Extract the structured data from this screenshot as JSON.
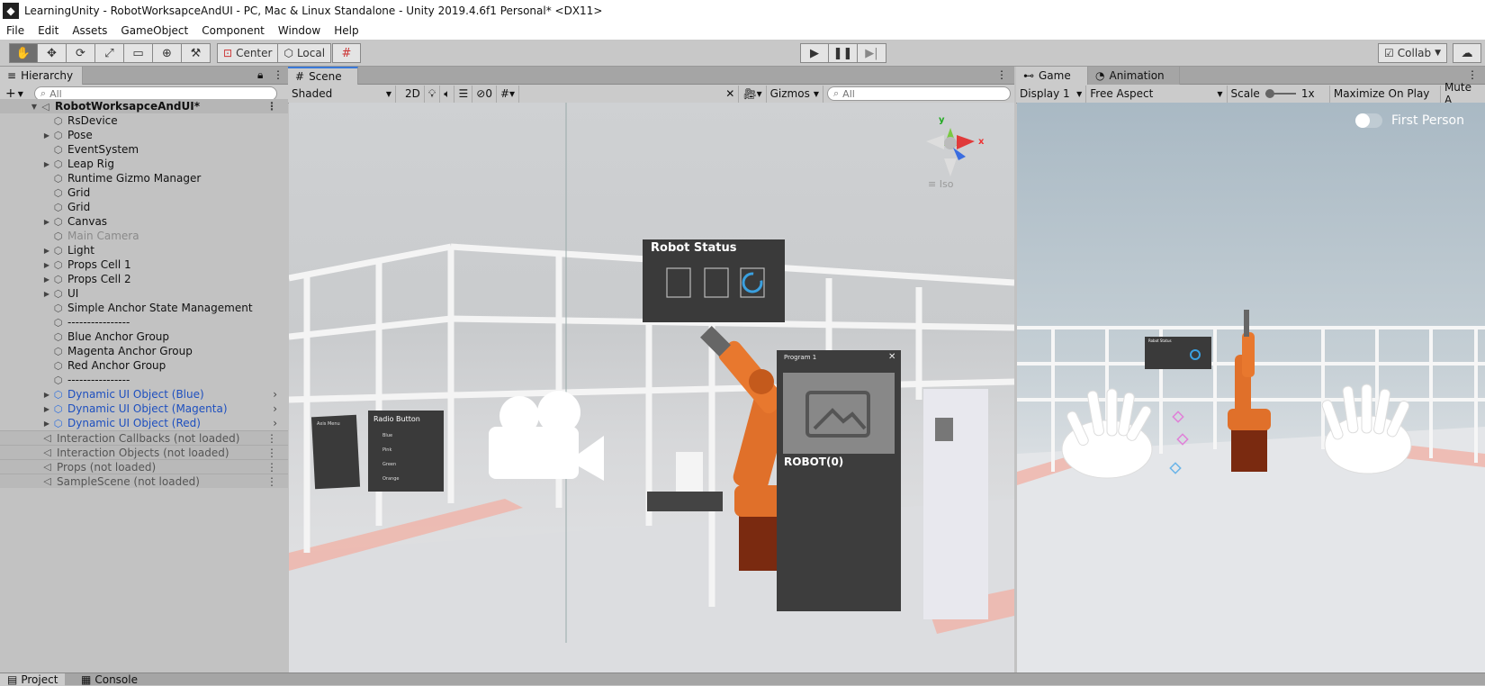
{
  "window": {
    "title": "LearningUnity - RobotWorksapceAndUI - PC, Mac & Linux Standalone - Unity 2019.4.6f1 Personal* <DX11>"
  },
  "menu": [
    "File",
    "Edit",
    "Assets",
    "GameObject",
    "Component",
    "Window",
    "Help"
  ],
  "toolbar": {
    "pivot_label": "Center",
    "space_label": "Local",
    "collab_label": "Collab"
  },
  "hierarchy": {
    "tab_label": "Hierarchy",
    "search_placeholder": "All",
    "root": "RobotWorksapceAndUI*",
    "items": [
      {
        "label": "RsDevice",
        "expand": false
      },
      {
        "label": "Pose",
        "expand": true
      },
      {
        "label": "EventSystem",
        "expand": false
      },
      {
        "label": "Leap Rig",
        "expand": true
      },
      {
        "label": "Runtime Gizmo Manager",
        "expand": false
      },
      {
        "label": "Grid",
        "expand": false
      },
      {
        "label": "Grid",
        "expand": false
      },
      {
        "label": "Canvas",
        "expand": true
      },
      {
        "label": "Main Camera",
        "expand": false
      },
      {
        "label": "Light",
        "expand": true
      },
      {
        "label": "Props Cell 1",
        "expand": true
      },
      {
        "label": "Props Cell 2",
        "expand": true
      },
      {
        "label": "UI",
        "expand": true
      },
      {
        "label": "Simple Anchor State Management",
        "expand": false
      },
      {
        "label": "----------------",
        "expand": false
      },
      {
        "label": "Blue Anchor Group",
        "expand": false
      },
      {
        "label": "Magenta Anchor Group",
        "expand": false
      },
      {
        "label": "Red Anchor Group",
        "expand": false
      },
      {
        "label": "----------------",
        "expand": false
      },
      {
        "label": "Dynamic UI Object (Blue)",
        "expand": true
      },
      {
        "label": "Dynamic UI Object (Magenta)",
        "expand": true
      },
      {
        "label": "Dynamic UI Object (Red)",
        "expand": true
      }
    ],
    "scenes": [
      "Interaction Callbacks (not loaded)",
      "Interaction Objects (not loaded)",
      "Props (not loaded)",
      "SampleScene (not loaded)"
    ]
  },
  "scene": {
    "tab_label": "Scene",
    "shading": "Shaded",
    "mode_2d": "2D",
    "hidden_count": "0",
    "gizmos_label": "Gizmos",
    "search_placeholder": "All",
    "iso_label": "Iso",
    "axis_y": "y",
    "axis_x": "x",
    "robot_status_title": "Robot Status",
    "radio_title": "Radio Button",
    "radio_options": [
      "Blue",
      "Pink",
      "Green",
      "Orange"
    ],
    "card_header": "Program 1",
    "card_title": "ROBOT(0)",
    "small_panel_title": "Axis Menu"
  },
  "game": {
    "tab_label": "Game",
    "animation_tab": "Animation",
    "display": "Display 1",
    "aspect": "Free Aspect",
    "scale_label": "Scale",
    "scale_value": "1x",
    "maximize": "Maximize On Play",
    "mute": "Mute A",
    "toggle_label": "First Person",
    "status_label": "Robot Status"
  },
  "bottom": {
    "tabs": [
      "Project",
      "Console"
    ]
  },
  "colors": {
    "accent": "#2a6de0",
    "robot": "#e0702a",
    "panel": "#3a3a3a"
  }
}
